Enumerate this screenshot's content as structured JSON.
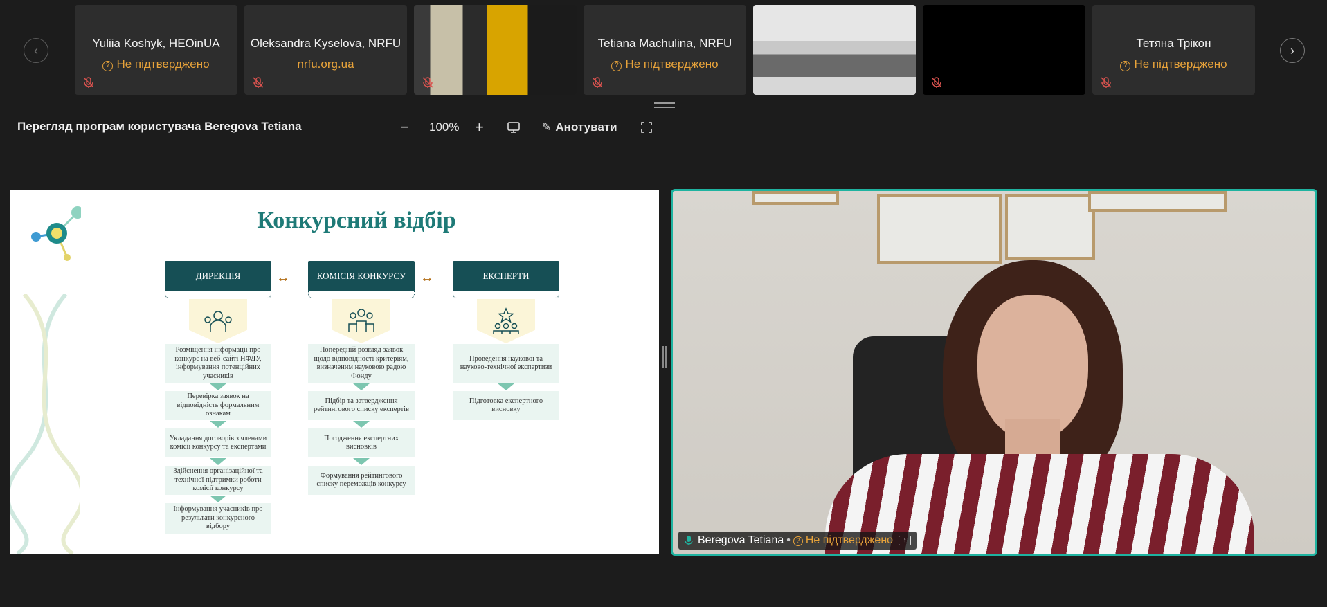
{
  "participants": [
    {
      "name": "Yuliia Koshyk, HEOinUA",
      "status": "Не підтверджено"
    },
    {
      "name": "Oleksandra Kyselova, NRFU",
      "status": "nrfu.org.ua"
    },
    {
      "name": "",
      "status": ""
    },
    {
      "name": "Tetiana Machulina, NRFU",
      "status": "Не підтверджено"
    },
    {
      "name": "",
      "status": ""
    },
    {
      "name": "",
      "status": ""
    },
    {
      "name": "Тетяна Трікон",
      "status": "Не підтверджено"
    }
  ],
  "share": {
    "title": "Перегляд програм користувача Beregova Tetiana",
    "zoom": "100%",
    "annotate_label": "Анотувати"
  },
  "slide": {
    "title": "Конкурсний відбір",
    "columns": [
      {
        "head": "ДИРЕКЦІЯ",
        "items": [
          "Розміщення інформації про конкурс на веб-сайті НФДУ, інформування потенційних учасників",
          "Перевірка заявок на відповідність формальним ознакам",
          "Укладання договорів з членами комісії конкурсу та експертами",
          "Здійснення організаційної та технічної підтримки роботи комісії конкурсу",
          "Інформування учасників про результати конкурсного відбору"
        ]
      },
      {
        "head": "КОМІСІЯ КОНКУРСУ",
        "items": [
          "Попередній розгляд заявок щодо відповідності критеріям, визначеним науковою радою Фонду",
          "Підбір та затвердження рейтингового списку експертів",
          "Погодження експертних висновків",
          "Формування рейтингового списку переможців конкурсу"
        ]
      },
      {
        "head": "ЕКСПЕРТИ",
        "items": [
          "Проведення наукової та науково-технічної експертизи",
          "Підготовка експертного висновку"
        ]
      }
    ]
  },
  "speaker": {
    "name": "Beregova Tetiana",
    "separator": "•",
    "status": "Не підтверджено"
  },
  "colors": {
    "accent": "#1fb3a0",
    "warning": "#e8a33a",
    "slide_title": "#1e7a77",
    "column_head": "#164f55"
  }
}
